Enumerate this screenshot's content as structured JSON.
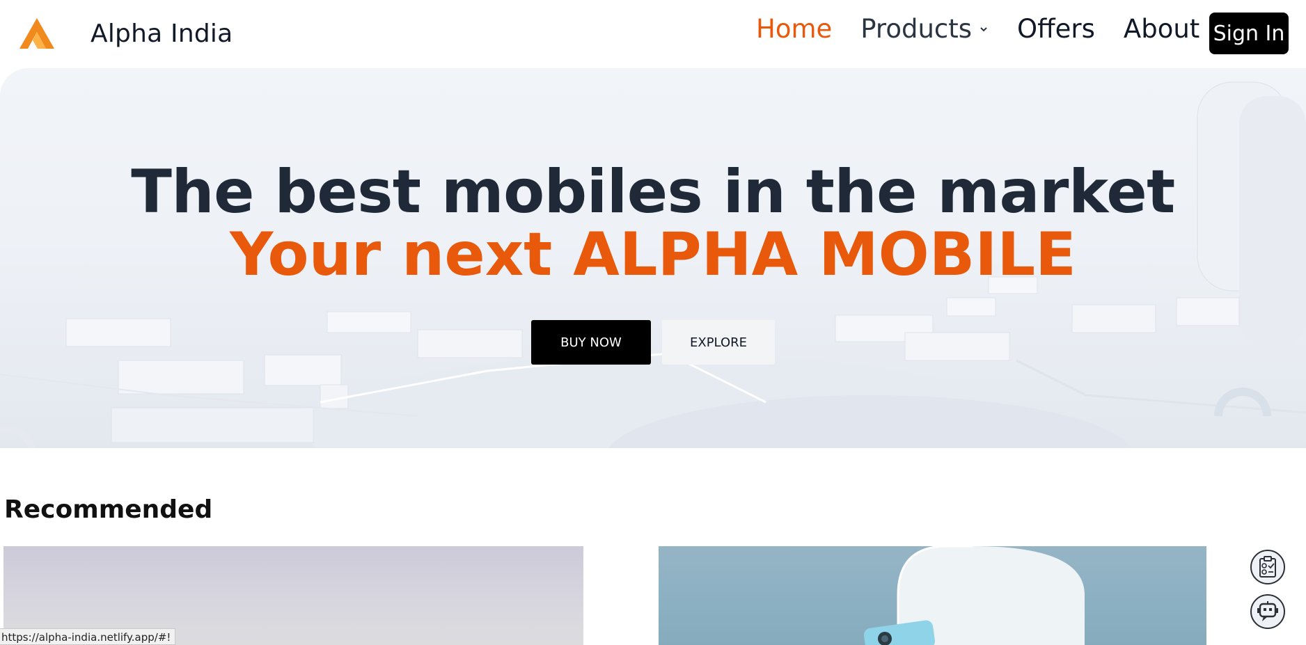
{
  "brand": {
    "name": "Alpha India",
    "accent": "#e8590c",
    "dark": "#1f2937"
  },
  "nav": {
    "items": [
      {
        "label": "Home",
        "active": true
      },
      {
        "label": "Products",
        "has_dropdown": true
      },
      {
        "label": "Offers"
      },
      {
        "label": "About"
      }
    ],
    "signin_label": "Sign In"
  },
  "hero": {
    "title_line1": "The best mobiles in the market",
    "title_line2": "Your next ALPHA MOBILE",
    "buy_label": "BUY NOW",
    "explore_label": "EXPLORE"
  },
  "recommended": {
    "title": "Recommended"
  },
  "widgets": {
    "icons": [
      "checklist-icon",
      "chatbot-icon"
    ]
  },
  "status_bar": {
    "url": "https://alpha-india.netlify.app/#!"
  }
}
